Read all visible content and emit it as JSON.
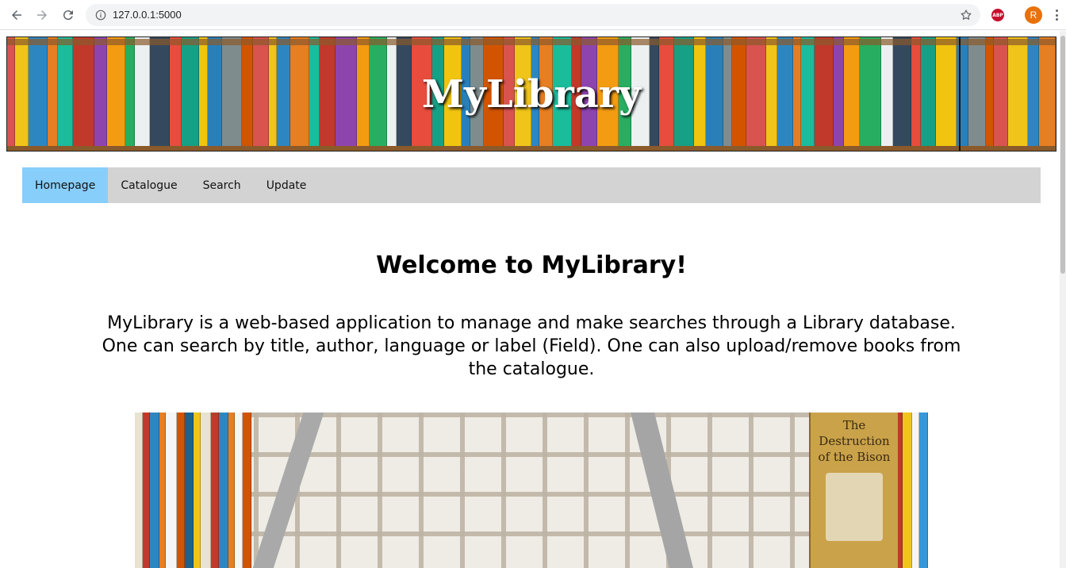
{
  "browser": {
    "url": "127.0.0.1:5000",
    "adblock_label": "ABP",
    "profile_initial": "R",
    "accent_colors": {
      "profile": "#e8710a",
      "adblock": "#c70d2c"
    }
  },
  "header": {
    "site_title": "MyLibrary"
  },
  "nav": {
    "items": [
      {
        "label": "Homepage",
        "active": true
      },
      {
        "label": "Catalogue",
        "active": false
      },
      {
        "label": "Search",
        "active": false
      },
      {
        "label": "Update",
        "active": false
      }
    ],
    "active_color": "#87cefa",
    "bar_color": "#d3d3d3"
  },
  "main": {
    "heading": "Welcome to MyLibrary!",
    "intro_lines": [
      "MyLibrary is a web-based application to manage and make searches through a Library database.",
      "One can search by title, author, language or label (Field). One can also upload/remove books from",
      "the catalogue."
    ],
    "photo_book_title": "The Destruction of the Bison"
  }
}
